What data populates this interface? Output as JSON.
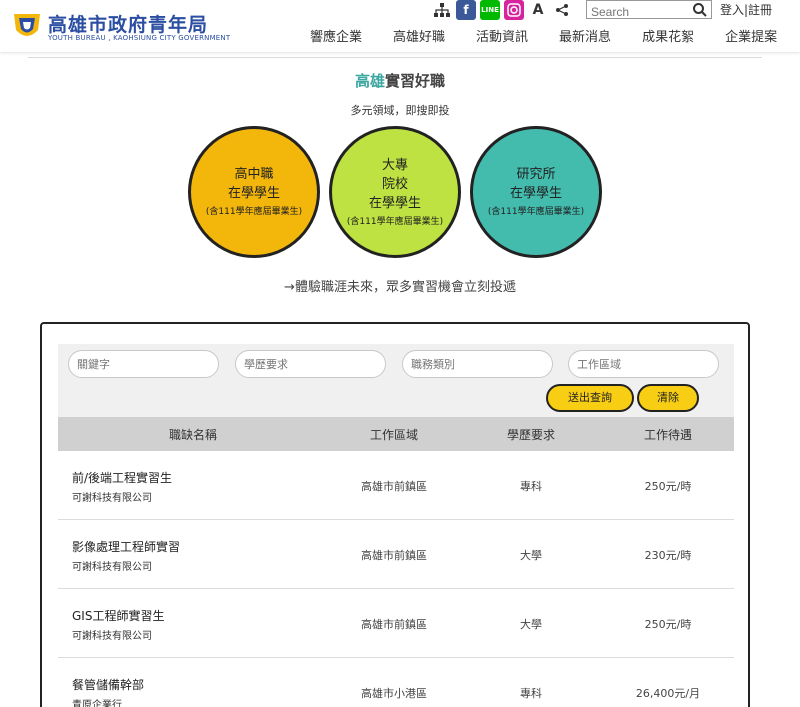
{
  "header": {
    "brand_title": "高雄市政府青年局",
    "brand_subtitle": "YOUTH BUREAU , KAOHSIUNG CITY GOVERNMENT",
    "search_placeholder": "Search",
    "login_label": "登入|註冊",
    "icons": [
      "sitemap-icon",
      "facebook-icon",
      "line-icon",
      "instagram-icon",
      "font-size-icon",
      "share-icon"
    ],
    "font_size_glyph": "A",
    "nav": [
      "響應企業",
      "高雄好職",
      "活動資訊",
      "最新消息",
      "成果花絮",
      "企業提案"
    ]
  },
  "intro": {
    "title_accent": "高雄",
    "title_rest": "實習好職",
    "subtitle": "多元領域，即搜即投",
    "circles": [
      {
        "lines": [
          "高中職",
          "在學學生"
        ],
        "note": "(含111學年應屆畢業生)",
        "color": "#f3b60b"
      },
      {
        "lines": [
          "大專",
          "院校",
          "在學學生"
        ],
        "note": "(含111學年應屆畢業生)",
        "color": "#bde241"
      },
      {
        "lines": [
          "研究所",
          "在學學生"
        ],
        "note": "(含111學年應屆畢業生)",
        "color": "#43bcae"
      }
    ],
    "tagline": "→體驗職涯未來，眾多實習機會立刻投遞"
  },
  "filters": {
    "keyword_placeholder": "關鍵字",
    "education_placeholder": "學歷要求",
    "category_placeholder": "職務類別",
    "area_placeholder": "工作區域",
    "submit_label": "送出查詢",
    "clear_label": "清除"
  },
  "table": {
    "headers": [
      "職缺名稱",
      "工作區域",
      "學歷要求",
      "工作待遇"
    ],
    "rows": [
      {
        "title": "前/後端工程實習生",
        "company": "可謝科技有限公司",
        "area": "高雄市前鎮區",
        "edu": "專科",
        "pay": "250元/時"
      },
      {
        "title": "影像處理工程師實習",
        "company": "可謝科技有限公司",
        "area": "高雄市前鎮區",
        "edu": "大學",
        "pay": "230元/時"
      },
      {
        "title": "GIS工程師實習生",
        "company": "可謝科技有限公司",
        "area": "高雄市前鎮區",
        "edu": "大學",
        "pay": "250元/時"
      },
      {
        "title": "餐管儲備幹部",
        "company": "青原企業行",
        "area": "高雄市小港區",
        "edu": "專科",
        "pay": "26,400元/月"
      }
    ]
  },
  "colors": {
    "brand": "#2b4ea2",
    "accent_teal": "#3ca6a0",
    "button_yellow": "#f7ce13",
    "facebook": "#3b5998",
    "line": "#00b900",
    "instagram": "#d6249f"
  }
}
